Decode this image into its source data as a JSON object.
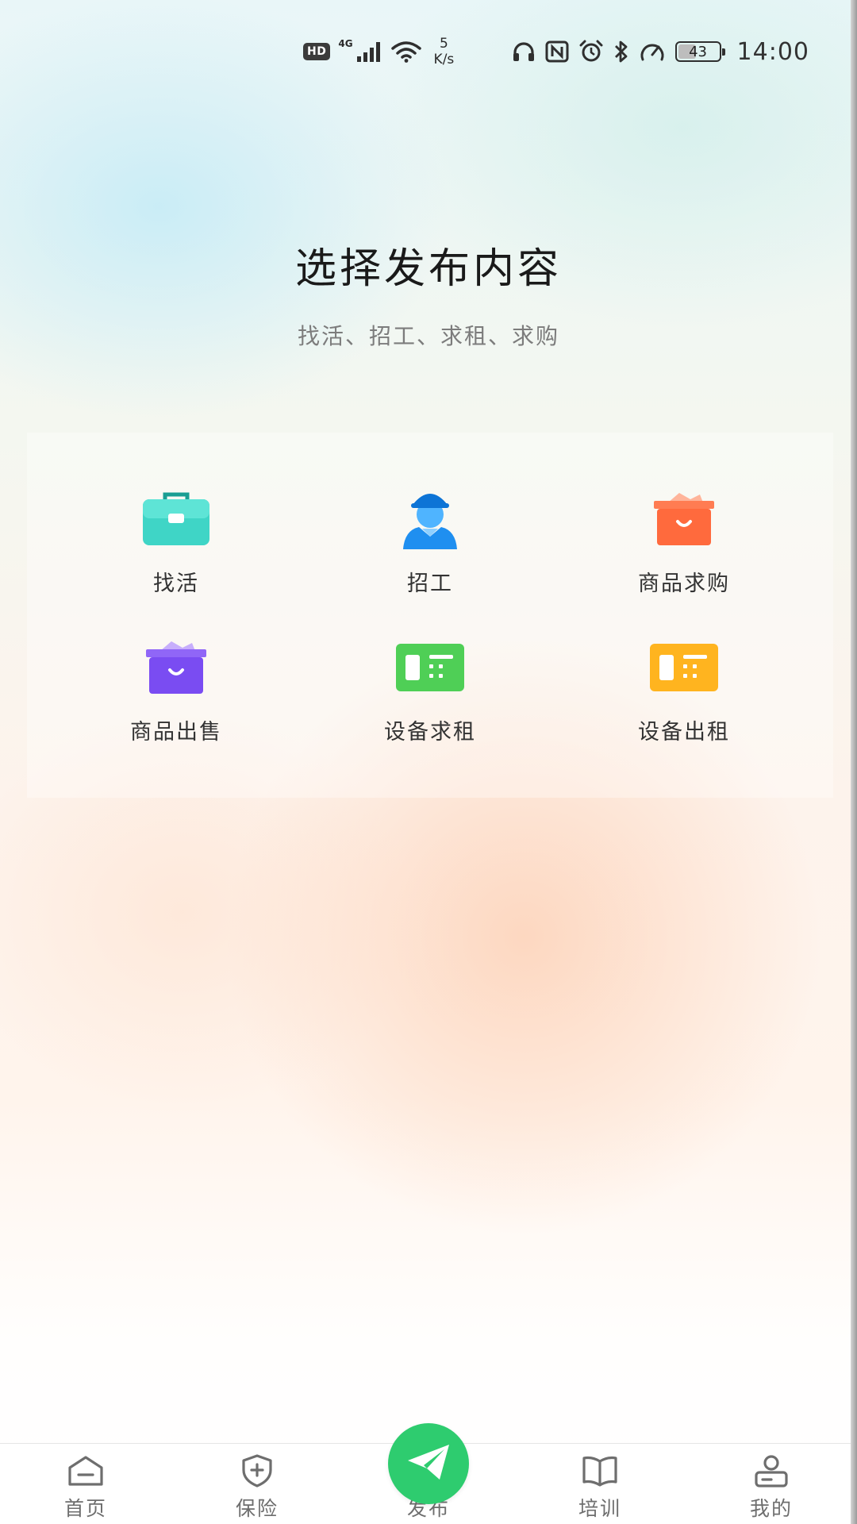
{
  "status_bar": {
    "hd_badge": "HD",
    "network_type": "4G",
    "net_speed_value": "5",
    "net_speed_unit": "K/s",
    "battery_level": "43",
    "battery_fraction": 0.43,
    "time": "14:00",
    "icons": [
      "signal-icon",
      "wifi-icon",
      "headphones-icon",
      "nfc-icon",
      "alarm-icon",
      "bluetooth-icon",
      "speed-gauge-icon",
      "battery-icon"
    ]
  },
  "header": {
    "title": "选择发布内容",
    "subtitle": "找活、招工、求租、求购"
  },
  "options": [
    {
      "label": "找活",
      "icon": "toolbox-icon",
      "color": "#3fd5c6"
    },
    {
      "label": "招工",
      "icon": "worker-icon",
      "color": "#1f8ff0"
    },
    {
      "label": "商品求购",
      "icon": "shopping-box-icon",
      "color": "#ff6a3d"
    },
    {
      "label": "商品出售",
      "icon": "shopping-box-icon",
      "color": "#7a4cf2"
    },
    {
      "label": "设备求租",
      "icon": "equipment-card-icon",
      "color": "#4fcf56"
    },
    {
      "label": "设备出租",
      "icon": "equipment-card-icon",
      "color": "#ffb41f"
    }
  ],
  "bottom_nav": {
    "items": [
      {
        "label": "首页",
        "icon": "home-icon"
      },
      {
        "label": "保险",
        "icon": "shield-plus-icon"
      },
      {
        "label": "发布",
        "icon": "send-icon"
      },
      {
        "label": "培训",
        "icon": "book-icon"
      },
      {
        "label": "我的",
        "icon": "profile-icon"
      }
    ],
    "accent": "#2ecc6f"
  }
}
